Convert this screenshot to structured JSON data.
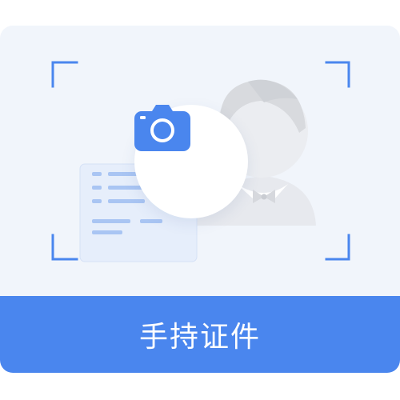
{
  "upload_card": {
    "label": "手持证件",
    "accent_color": "#4a86ee",
    "background_color": "#f1f5fb",
    "icons": {
      "camera": "camera-icon",
      "person": "person-illustration",
      "id_card": "id-card-illustration",
      "frame": "viewfinder-corner"
    }
  }
}
